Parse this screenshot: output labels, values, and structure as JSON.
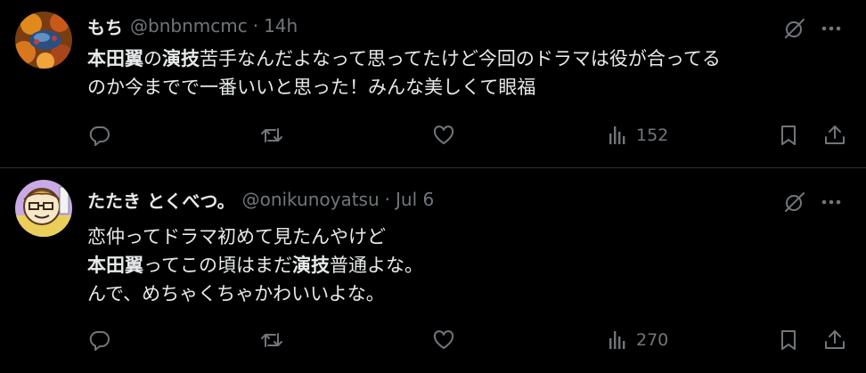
{
  "tweets": [
    {
      "display_name": "もち",
      "handle": "@bnbnmcmc",
      "separator": "·",
      "time": "14h",
      "lines": [
        [
          {
            "t": "本田翼",
            "bold": true
          },
          {
            "t": "の",
            "bold": false
          },
          {
            "t": "演技",
            "bold": true
          },
          {
            "t": "苦手なんだよなって思ってたけど今回のドラマは役が合ってる",
            "bold": false
          }
        ],
        [
          {
            "t": "のか今までで一番いいと思った！みんな美しくて眼福",
            "bold": false
          }
        ]
      ],
      "views": "152"
    },
    {
      "display_name": "たたき とくべつ。",
      "handle": "@onikunoyatsu",
      "separator": "·",
      "time": "Jul 6",
      "lines": [
        [
          {
            "t": "恋仲ってドラマ初めて見たんやけど",
            "bold": false
          }
        ],
        [
          {
            "t": "本田翼",
            "bold": true
          },
          {
            "t": "ってこの頃はまだ",
            "bold": false
          },
          {
            "t": "演技",
            "bold": true
          },
          {
            "t": "普通よな。",
            "bold": false
          }
        ],
        [
          {
            "t": "んで、めちゃくちゃかわいいよな。",
            "bold": false
          }
        ]
      ],
      "views": "270"
    }
  ],
  "icons": {
    "reply": "reply-icon",
    "repost": "repost-icon",
    "like": "like-icon",
    "views": "views-icon",
    "bookmark": "bookmark-icon",
    "share": "share-icon",
    "grok": "grok-icon",
    "more": "more-icon"
  },
  "colors": {
    "background": "#000000",
    "text": "#e7e9ea",
    "muted": "#71767b",
    "divider": "#2f3336"
  }
}
